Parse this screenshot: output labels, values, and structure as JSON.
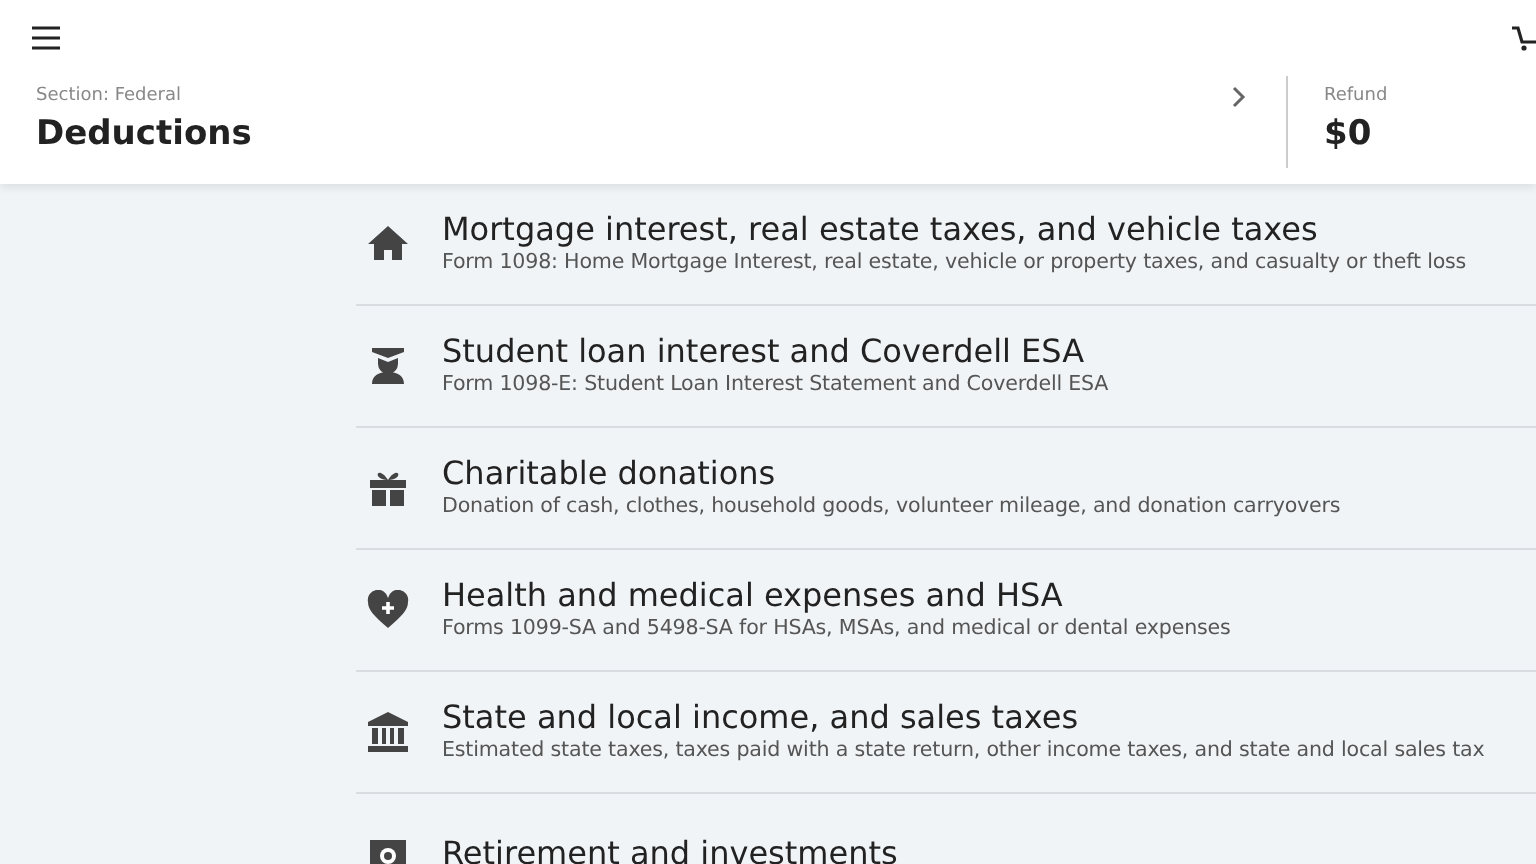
{
  "header": {
    "section_label": "Section: Federal",
    "section_title": "Deductions",
    "refund_label": "Refund",
    "refund_amount": "$0"
  },
  "items": [
    {
      "title": "Mortgage interest, real estate taxes, and vehicle taxes",
      "subtitle": "Form 1098: Home Mortgage Interest, real estate, vehicle or property taxes, and casualty or theft loss"
    },
    {
      "title": "Student loan interest and Coverdell ESA",
      "subtitle": "Form 1098-E: Student Loan Interest Statement and Coverdell ESA"
    },
    {
      "title": "Charitable donations",
      "subtitle": "Donation of cash, clothes, household goods, volunteer mileage, and donation carryovers"
    },
    {
      "title": "Health and medical expenses and HSA",
      "subtitle": "Forms 1099-SA and 5498-SA for HSAs, MSAs, and medical or dental expenses"
    },
    {
      "title": "State and local income, and sales taxes",
      "subtitle": "Estimated state taxes, taxes paid with a state return, other income taxes, and state and local sales tax"
    },
    {
      "title": "Retirement and investments"
    }
  ]
}
